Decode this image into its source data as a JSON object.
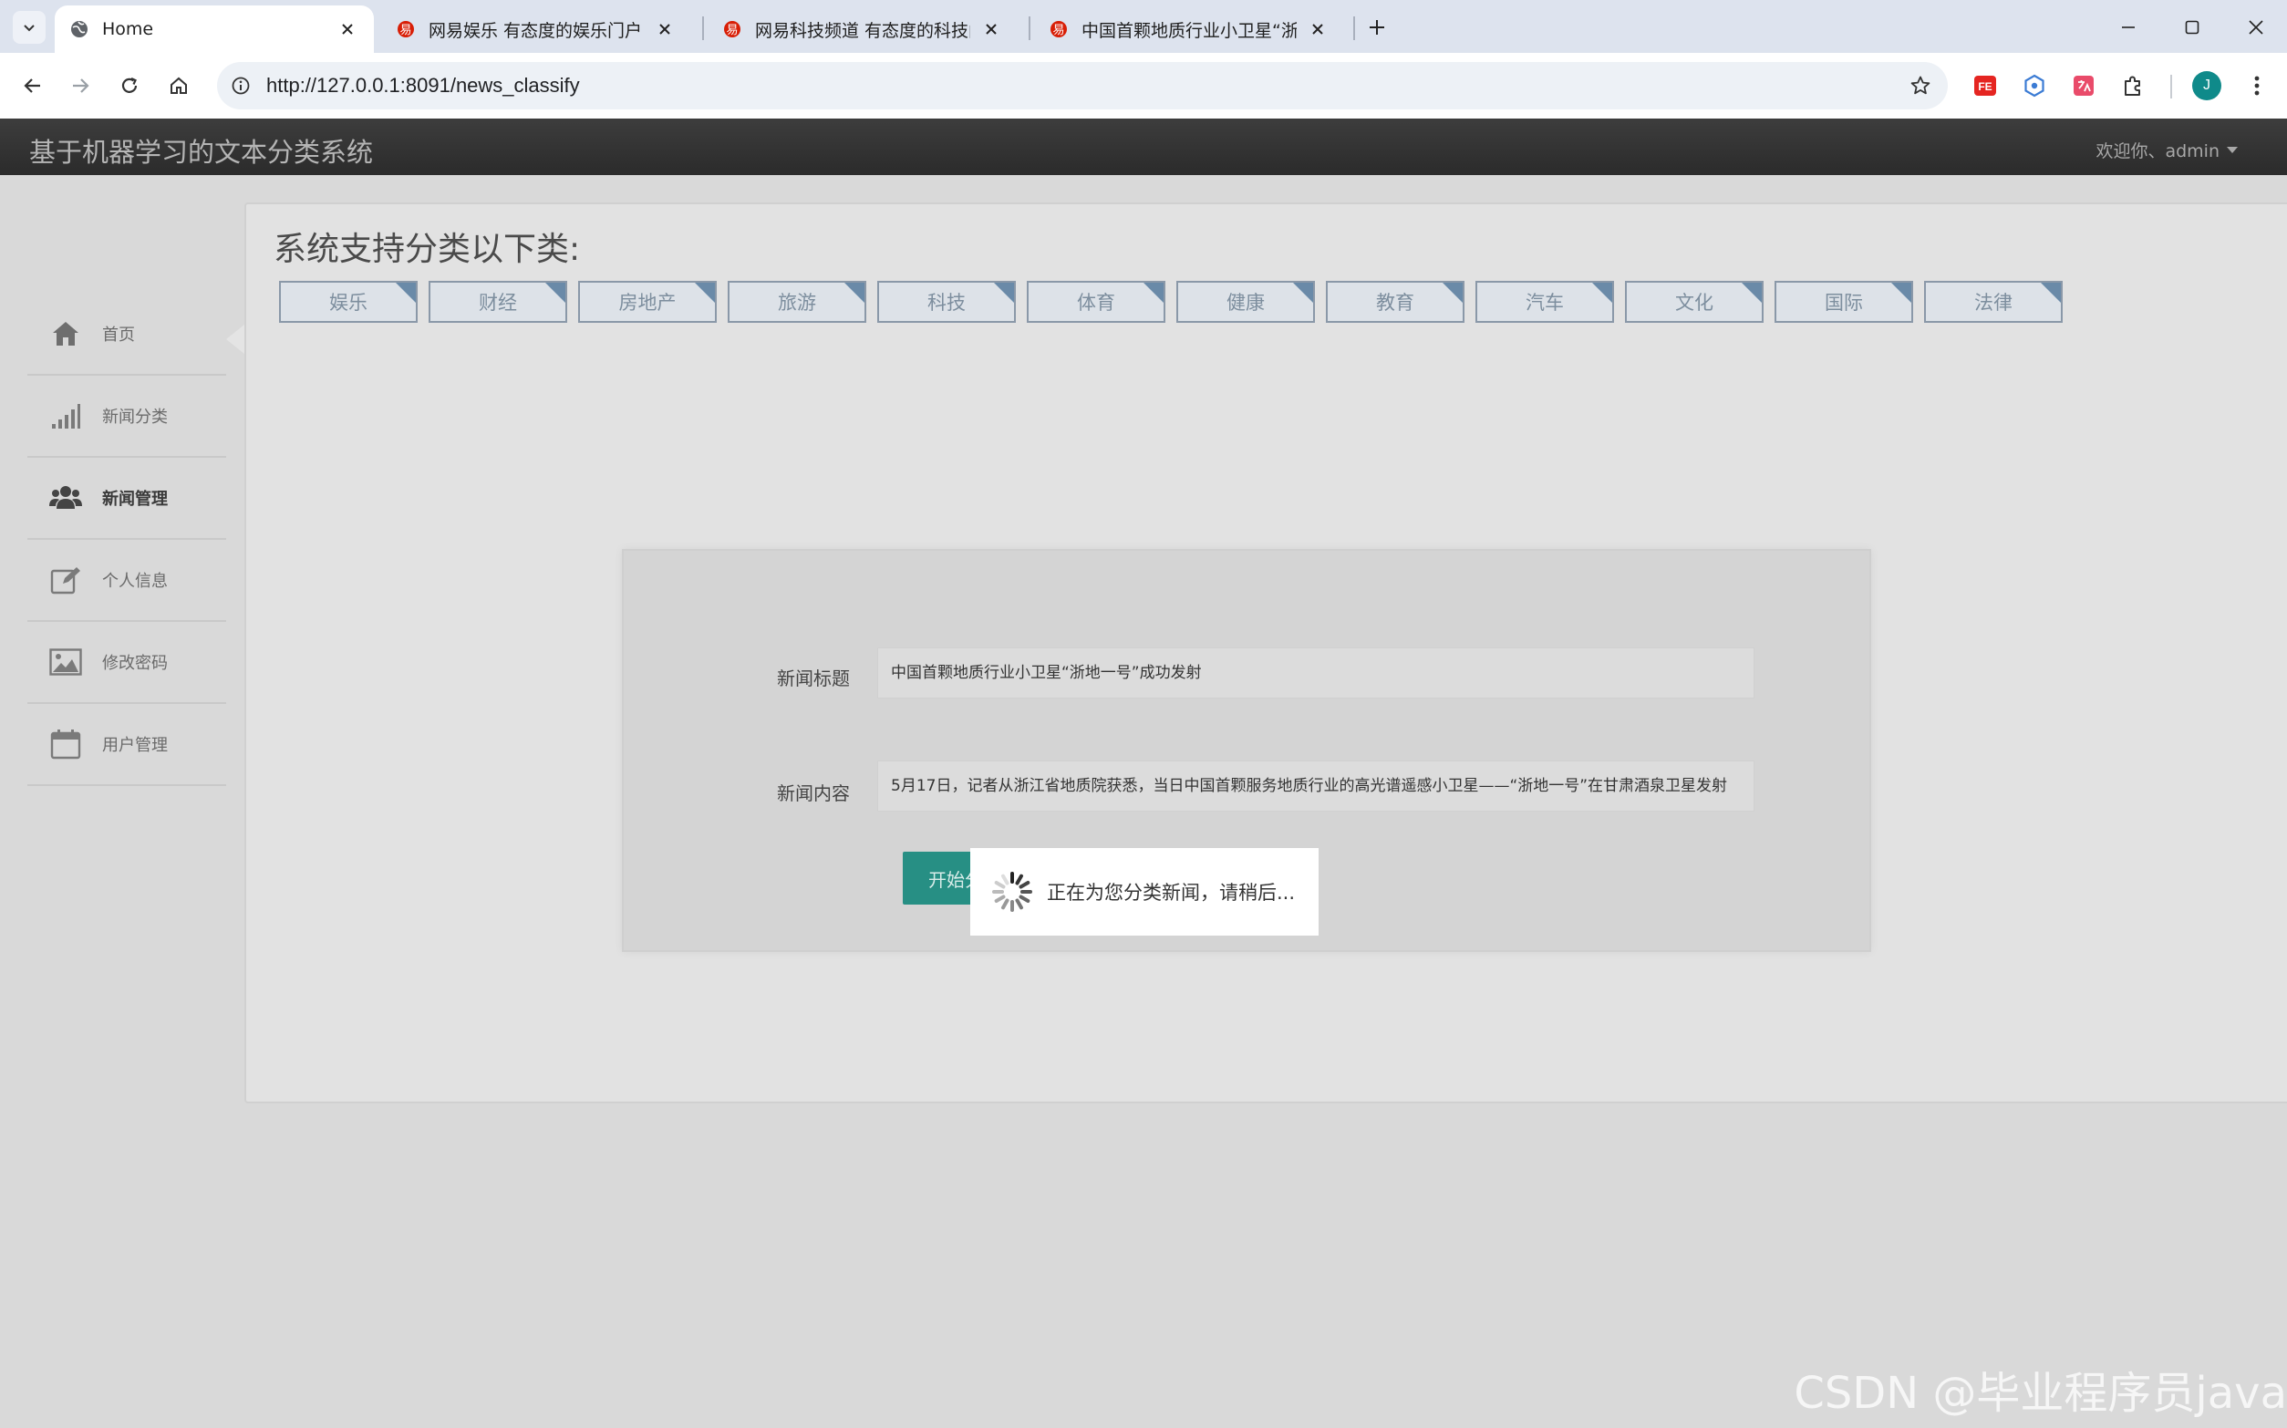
{
  "browser": {
    "tabs": [
      {
        "title": "Home",
        "icon": "globe-icon"
      },
      {
        "title": "网易娱乐 有态度的娱乐门户",
        "icon": "netease-icon"
      },
      {
        "title": "网易科技频道 有态度的科技门户",
        "icon": "netease-icon"
      },
      {
        "title": "中国首颗地质行业小卫星“浙地一号”成功发射",
        "icon": "netease-icon"
      }
    ],
    "url": "http://127.0.0.1:8091/news_classify",
    "profile_initial": "J"
  },
  "navbar": {
    "brand": "基于机器学习的文本分类系统",
    "welcome": "欢迎你、admin"
  },
  "sidebar": {
    "items": [
      {
        "label": "首页",
        "icon": "home-icon"
      },
      {
        "label": "新闻分类",
        "icon": "signal-bars-icon"
      },
      {
        "label": "新闻管理",
        "icon": "users-icon"
      },
      {
        "label": "个人信息",
        "icon": "edit-icon"
      },
      {
        "label": "修改密码",
        "icon": "picture-icon"
      },
      {
        "label": "用户管理",
        "icon": "calendar-icon"
      }
    ]
  },
  "main": {
    "heading": "系统支持分类以下类:",
    "categories": [
      "娱乐",
      "财经",
      "房地产",
      "旅游",
      "科技",
      "体育",
      "健康",
      "教育",
      "汽车",
      "文化",
      "国际",
      "法律"
    ],
    "form": {
      "title_label": "新闻标题",
      "title_value": "中国首颗地质行业小卫星“浙地一号”成功发射",
      "content_label": "新闻内容",
      "content_value": "5月17日，记者从浙江省地质院获悉，当日中国首颗服务地质行业的高光谱遥感小卫星——“浙地一号”在甘肃酒泉卫星发射",
      "submit_label": "开始分类"
    }
  },
  "loading": {
    "text": "正在为您分类新闻，请稍后..."
  },
  "watermark": "CSDN @毕业程序员java",
  "colors": {
    "navbar": "#2f2f2f",
    "button_teal": "#278f84",
    "tag_border": "#8a98a8",
    "tag_corner": "#6a8aa8"
  }
}
